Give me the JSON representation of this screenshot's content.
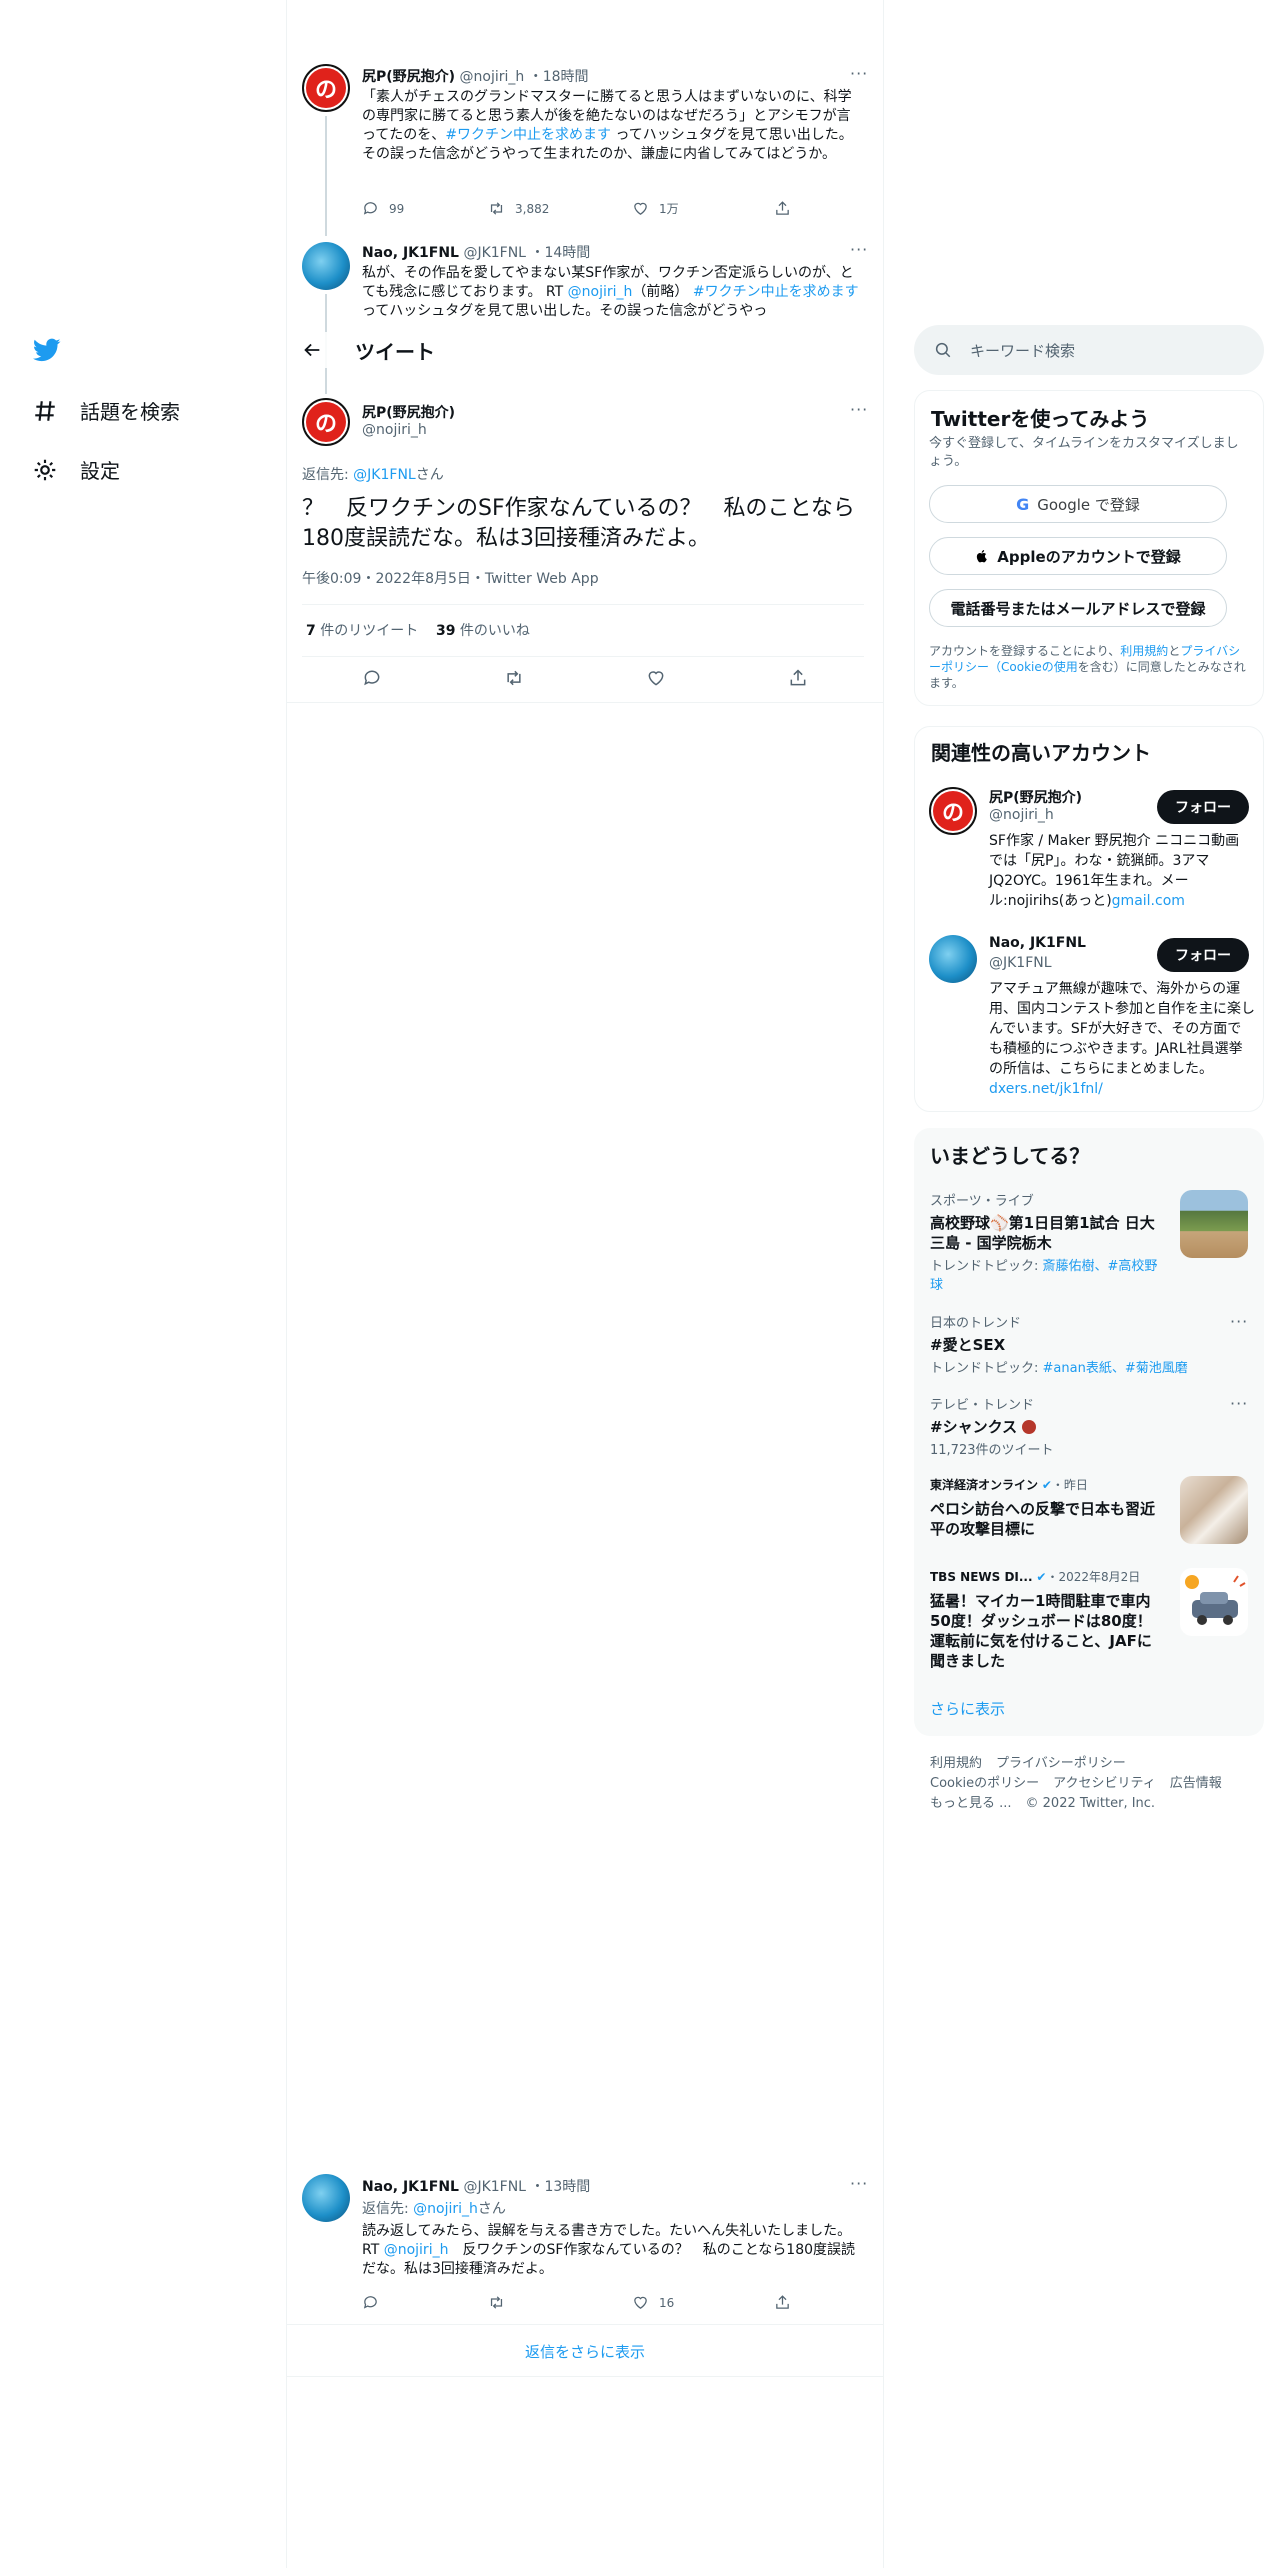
{
  "nav": {
    "explore_label": "話題を検索",
    "settings_label": "設定"
  },
  "thread": {
    "tweet1": {
      "name": "尻P(野尻抱介)",
      "handle": "@nojiri_h",
      "time": "18時間",
      "body_a": "「素人がチェスのグランドマスターに勝てると思う人はまずいないのに、科学の専門家に勝てると思う素人が後を絶たないのはなぜだろう」とアシモフが言ってたのを、",
      "hashtag": "#ワクチン中止を求めます",
      "body_b": " ってハッシュタグを見て思い出した。その誤った信念がどうやって生まれたのか、謙虚に内省してみてはどうか。",
      "replies": "99",
      "retweets": "3,882",
      "likes": "1万"
    },
    "tweet2": {
      "name": "Nao, JK1FNL",
      "handle": "@JK1FNL",
      "time": "14時間",
      "body_a": "私が、その作品を愛してやまない某SF作家が、ワクチン否定派らしいのが、とても残念に感じております。 RT ",
      "mention": "@nojiri_h",
      "body_b": "（前略） ",
      "hashtag": "#ワクチン中止を求めます",
      "body_c": " ってハッシュタグを見て思い出した。その誤った信念がどうやっ"
    }
  },
  "main_tweet": {
    "header_title": "ツイート",
    "name": "尻P(野尻抱介)",
    "handle": "@nojiri_h",
    "reply_prefix": "返信先: ",
    "reply_to": "@JK1FNL",
    "reply_suffix": "さん",
    "text": "？　反ワクチンのSF作家なんているの？　私のことなら180度誤読だな。私は3回接種済みだよ。",
    "timestamp": "午後0:09・2022年8月5日・Twitter Web App",
    "retweet_count": "7",
    "retweet_label": " 件のリツイート",
    "like_count": "39",
    "like_label": " 件のいいね"
  },
  "reply_tweet": {
    "name": "Nao, JK1FNL",
    "handle": "@JK1FNL",
    "time": "13時間",
    "reply_prefix": "返信先: ",
    "reply_to": "@nojiri_h",
    "reply_suffix": "さん",
    "body_a": "読み返してみたら、誤解を与える書き方でした。たいへん失礼いたしました。 RT ",
    "mention": "@nojiri_h",
    "body_b": "　反ワクチンのSF作家なんているの？　私のことなら180度誤読だな。私は3回接種済みだよ。",
    "likes": "16"
  },
  "show_more_replies": "返信をさらに表示",
  "search": {
    "placeholder": "キーワード検索"
  },
  "signup": {
    "title": "Twitterを使ってみよう",
    "subtitle": "今すぐ登録して、タイムラインをカスタマイズしましょう。",
    "google_button": "Google で登録",
    "apple_button": "Appleのアカウントで登録",
    "phone_button": "電話番号またはメールアドレスで登録",
    "terms_a": "アカウントを登録することにより、",
    "terms_link1": "利用規約",
    "terms_b": "と",
    "terms_link2": "プライバシーポリシー（Cookieの使用",
    "terms_c": "を含む）に同意したとみなされます。"
  },
  "relevant": {
    "title": "関連性の高いアカウント",
    "follow_label": "フォロー",
    "accounts": [
      {
        "name": "尻P(野尻抱介)",
        "handle": "@nojiri_h",
        "bio": "SF作家 / Maker 野尻抱介 ニコニコ動画では「尻P」。わな・銃猟師。3アマ JQ2OYC。1961年生まれ。メール:nojirihs(あっと)",
        "bio_link": "gmail.com"
      },
      {
        "name": "Nao, JK1FNL",
        "handle": "@JK1FNL",
        "bio": "アマチュア無線が趣味で、海外からの運用、国内コンテスト参加と自作を主に楽しんでいます。SFが大好きで、その方面でも積極的につぶやきます。JARL社員選挙の所信は、こちらにまとめました。 ",
        "bio_link": "dxers.net/jk1fnl/"
      }
    ]
  },
  "trends": {
    "title": "いまどうしてる？",
    "items": [
      {
        "category": "スポーツ・ライブ",
        "title": "高校野球⚾第1日目第1試合 日大三島 - 国学院栃木",
        "sub_prefix": "トレンドトピック: ",
        "sub_links": "斎藤佑樹、#高校野球"
      },
      {
        "category": "日本のトレンド",
        "title": "#愛とSEX",
        "sub_prefix": "トレンドトピック: ",
        "sub_links": "#anan表紙、#菊池風磨"
      },
      {
        "category": "テレビ・トレンド",
        "title": "#シャンクス",
        "sub_prefix": "11,723件のツイート",
        "sub_links": ""
      },
      {
        "category": "東洋経済オンライン",
        "time": "・昨日",
        "title": "ペロシ訪台への反撃で日本も習近平の攻撃目標に"
      },
      {
        "category": "TBS NEWS DI...",
        "time": "・2022年8月2日",
        "title": "猛暑！マイカー1時間駐車で車内50度！ダッシュボードは80度！運転前に気を付けること、JAFに聞きました"
      }
    ],
    "show_more": "さらに表示"
  },
  "footer": {
    "terms": "利用規約",
    "privacy": "プライバシーポリシー",
    "cookie": "Cookieのポリシー",
    "accessibility": "アクセシビリティ",
    "ads": "広告情報",
    "more": "もっと見る ...",
    "copyright": "© 2022 Twitter, Inc."
  },
  "colors": {
    "accent": "#1d9bf0",
    "text": "#0f1419",
    "secondary": "#536471",
    "divider": "#eff3f4"
  }
}
